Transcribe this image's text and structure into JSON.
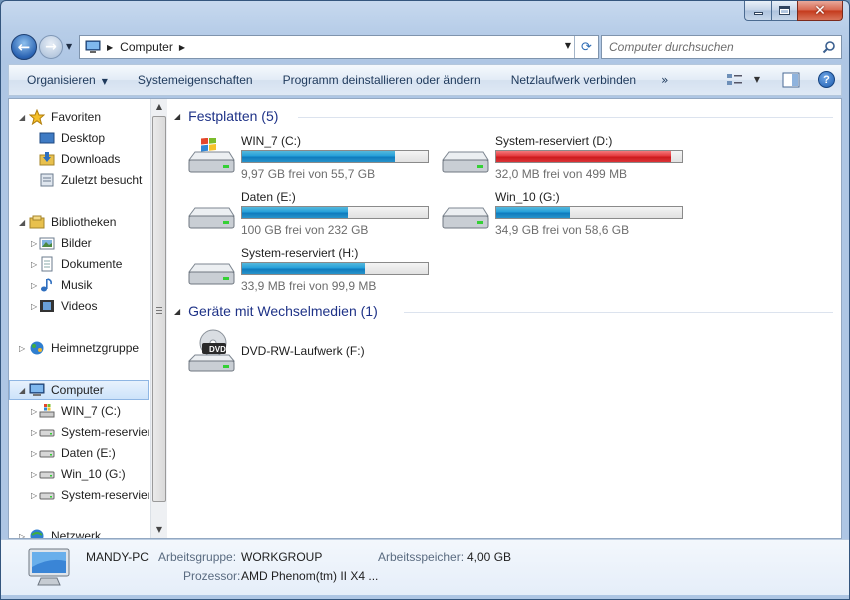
{
  "window": {
    "minimize_icon": "minimize-icon",
    "maximize_icon": "maximize-icon",
    "close_glyph": "✕"
  },
  "nav": {
    "back_glyph": "←",
    "forward_glyph": "→",
    "address_path": "Computer",
    "search_placeholder": "Computer durchsuchen"
  },
  "toolbar": {
    "organize": "Organisieren",
    "system_properties": "Systemeigenschaften",
    "uninstall": "Programm deinstallieren oder ändern",
    "map_network_drive": "Netzlaufwerk verbinden",
    "more": "»",
    "help": "?"
  },
  "sidebar": {
    "favorites": {
      "label": "Favoriten",
      "items": [
        "Desktop",
        "Downloads",
        "Zuletzt besucht"
      ]
    },
    "libraries": {
      "label": "Bibliotheken",
      "items": [
        "Bilder",
        "Dokumente",
        "Musik",
        "Videos"
      ]
    },
    "homegroup": "Heimnetzgruppe",
    "computer": {
      "label": "Computer",
      "items": [
        "WIN_7 (C:)",
        "System-reserviert",
        "Daten (E:)",
        "Win_10 (G:)",
        "System-reserviert"
      ]
    },
    "network": "Netzwerk"
  },
  "main": {
    "hard_drives_title": "Festplatten (5)",
    "removable_title": "Geräte mit Wechselmedien (1)",
    "drives": [
      {
        "name": "WIN_7 (C:)",
        "free": "9,97 GB frei von 55,7 GB",
        "used_fraction": 0.82,
        "color": "#26a0da"
      },
      {
        "name": "System-reserviert (D:)",
        "free": "32,0 MB frei von 499 MB",
        "used_fraction": 0.94,
        "color": "#e53a3e"
      },
      {
        "name": "Daten (E:)",
        "free": "100 GB frei von 232 GB",
        "used_fraction": 0.57,
        "color": "#26a0da"
      },
      {
        "name": "Win_10 (G:)",
        "free": "34,9 GB frei von 58,6 GB",
        "used_fraction": 0.4,
        "color": "#26a0da"
      },
      {
        "name": "System-reserviert (H:)",
        "free": "33,9 MB frei von 99,9 MB",
        "used_fraction": 0.66,
        "color": "#26a0da"
      }
    ],
    "dvd": {
      "name": "DVD-RW-Laufwerk (F:)",
      "badge": "DVD"
    }
  },
  "details": {
    "pc_name": "MANDY-PC",
    "workgroup_label": "Arbeitsgruppe:",
    "workgroup_value": "WORKGROUP",
    "memory_label": "Arbeitsspeicher:",
    "memory_value": "4,00 GB",
    "cpu_label": "Prozessor:",
    "cpu_value": "AMD Phenom(tm) II X4 ..."
  }
}
